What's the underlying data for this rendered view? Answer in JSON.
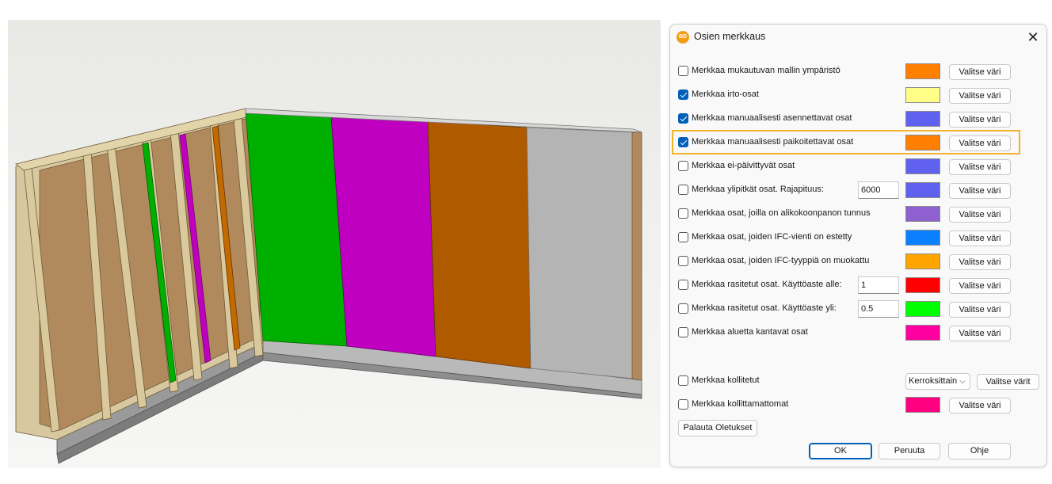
{
  "dialog": {
    "title": "Osien merkkaus",
    "app_icon_text": "BD",
    "close_glyph": "✕",
    "rows": [
      {
        "label": "Merkkaa mukautuvan mallin ympäristö",
        "checked": false,
        "color": "#ff7f00",
        "button": "Valitse väri"
      },
      {
        "label": "Merkkaa irto-osat",
        "checked": true,
        "color": "#ffff88",
        "button": "Valitse väri"
      },
      {
        "label": "Merkkaa manuaalisesti asennettavat osat",
        "checked": true,
        "color": "#6161f0",
        "button": "Valitse väri"
      },
      {
        "label": "Merkkaa manuaalisesti paikoitettavat osat",
        "checked": true,
        "color": "#ff7f00",
        "button": "Valitse väri"
      },
      {
        "label": "Merkkaa ei-päivittyvät osat",
        "checked": false,
        "color": "#6161f0",
        "button": "Valitse väri"
      },
      {
        "label": "Merkkaa ylipitkät osat. Rajapituus:",
        "checked": false,
        "color": "#6161f0",
        "button": "Valitse väri",
        "input": "6000"
      },
      {
        "label": "Merkkaa osat, joilla on alikokoonpanon tunnus",
        "checked": false,
        "color": "#8e60d0",
        "button": "Valitse väri"
      },
      {
        "label": "Merkkaa osat, joiden IFC-vienti on estetty",
        "checked": false,
        "color": "#0a80ff",
        "button": "Valitse väri"
      },
      {
        "label": "Merkkaa osat, joiden IFC-tyyppiä on muokattu",
        "checked": false,
        "color": "#ffa500",
        "button": "Valitse väri"
      },
      {
        "label": "Merkkaa rasitetut osat. Käyttöaste alle:",
        "checked": false,
        "color": "#ff0000",
        "button": "Valitse väri",
        "input": "1"
      },
      {
        "label": "Merkkaa rasitetut osat. Käyttöaste yli:",
        "checked": false,
        "color": "#00ff00",
        "button": "Valitse väri",
        "input": "0.5"
      },
      {
        "label": "Merkkaa aluetta kantavat osat",
        "checked": false,
        "color": "#ff00a0",
        "button": "Valitse väri"
      }
    ],
    "kollitetut": {
      "label": "Merkkaa kollitetut",
      "checked": false,
      "select_value": "Kerroksittain",
      "button": "Valitse värit"
    },
    "kollittamattomat": {
      "label": "Merkkaa kollittamattomat",
      "checked": false,
      "color": "#ff0080",
      "button": "Valitse väri"
    },
    "reset_button": "Palauta Oletukset",
    "ok_button": "OK",
    "cancel_button": "Peruuta",
    "help_button": "Ohje"
  },
  "viewport": {
    "panel_colors": {
      "green": "#00b000",
      "magenta": "#c000c0",
      "orange": "#b05a00",
      "gray": "#b4b4b4",
      "osb": "#b08a5c",
      "stud": "#d8c8a0"
    }
  }
}
